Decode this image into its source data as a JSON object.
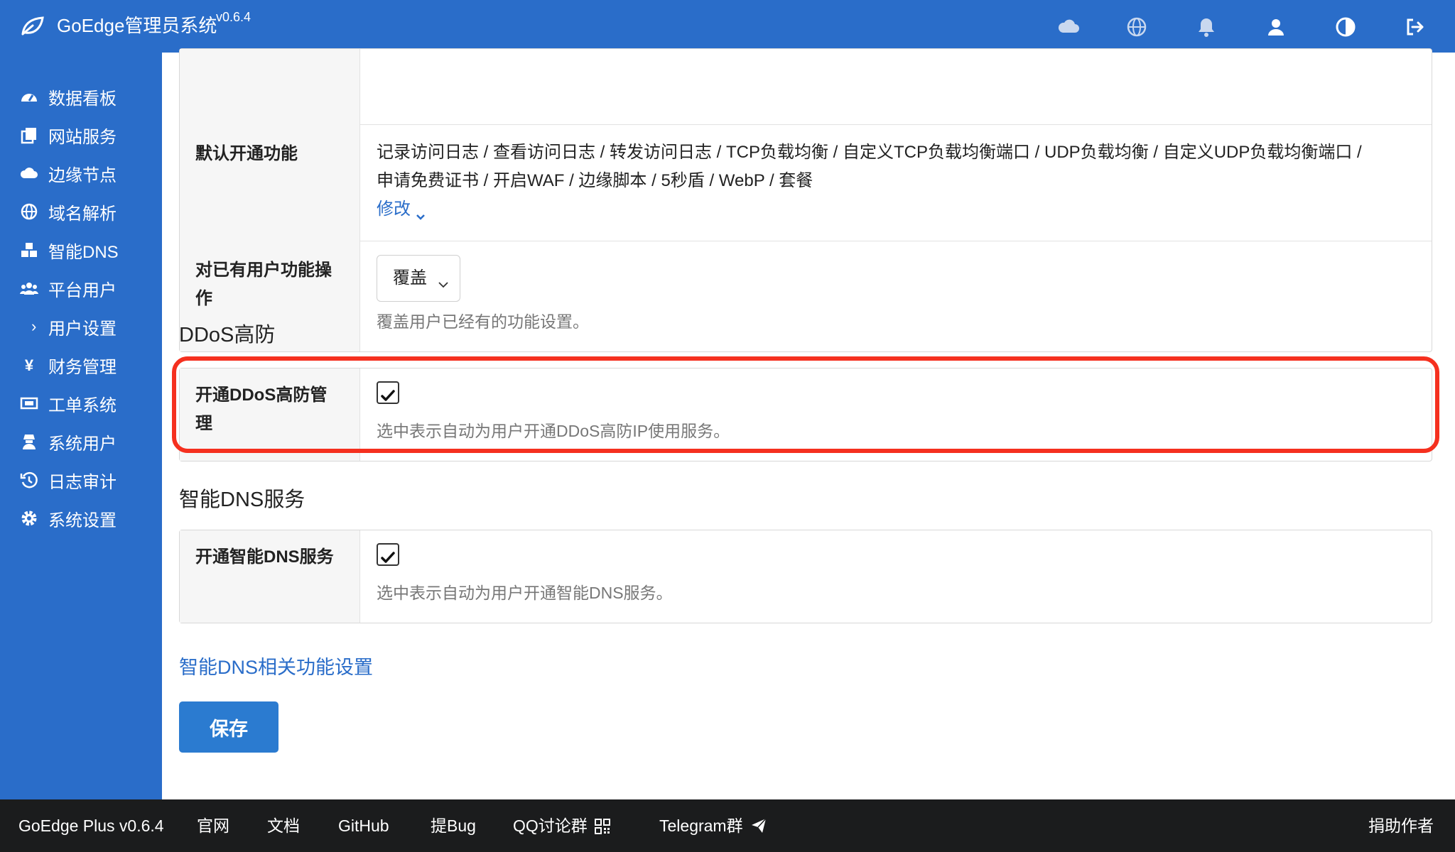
{
  "header": {
    "title": "GoEdge管理员系统",
    "version": "v0.6.4",
    "icons": [
      "cloud-icon",
      "globe-icon",
      "bell-icon",
      "user-icon",
      "theme-toggle-icon",
      "logout-icon"
    ]
  },
  "sidebar": {
    "items": [
      {
        "label": "数据看板",
        "icon": "dashboard-icon"
      },
      {
        "label": "网站服务",
        "icon": "copy-icon"
      },
      {
        "label": "边缘节点",
        "icon": "cloud-icon"
      },
      {
        "label": "域名解析",
        "icon": "globe-icon"
      },
      {
        "label": "智能DNS",
        "icon": "cubes-icon"
      },
      {
        "label": "平台用户",
        "icon": "users-icon"
      },
      {
        "label": "用户设置",
        "icon": "chevron-right-icon",
        "sub": true
      },
      {
        "label": "财务管理",
        "icon": "yen-icon"
      },
      {
        "label": "工单系统",
        "icon": "ticket-icon"
      },
      {
        "label": "系统用户",
        "icon": "user-secret-icon"
      },
      {
        "label": "日志审计",
        "icon": "history-icon"
      },
      {
        "label": "系统设置",
        "icon": "gear-icon"
      }
    ]
  },
  "features_panel": {
    "default_features_label": "默认开通功能",
    "default_features_value_line1": "记录访问日志 / 查看访问日志 / 转发访问日志 / TCP负载均衡 / 自定义TCP负载均衡端口 / UDP负载均衡 / 自定义UDP负载均衡端口 /",
    "default_features_value_line2": "申请免费证书 / 开启WAF / 边缘脚本 / 5秒盾 / WebP / 套餐",
    "modify_link": "修改",
    "existing_users_label": "对已有用户功能操作",
    "existing_users_select": "覆盖",
    "existing_users_help": "覆盖用户已经有的功能设置。"
  },
  "ddos": {
    "section_title": "DDoS高防",
    "label": "开通DDoS高防管理",
    "checked": true,
    "help": "选中表示自动为用户开通DDoS高防IP使用服务。"
  },
  "dns": {
    "section_title": "智能DNS服务",
    "label": "开通智能DNS服务",
    "checked": true,
    "help": "选中表示自动为用户开通智能DNS服务。",
    "settings_link": "智能DNS相关功能设置"
  },
  "actions": {
    "save_label": "保存"
  },
  "footer": {
    "version": "GoEdge Plus v0.6.4",
    "official_site": "官网",
    "docs": "文档",
    "github": "GitHub",
    "bug": "提Bug",
    "qq": "QQ讨论群",
    "telegram": "Telegram群",
    "donate": "捐助作者"
  },
  "colors": {
    "primary": "#2a6dc9",
    "highlight": "#f5301f",
    "footer_bg": "#1b1c1d"
  }
}
